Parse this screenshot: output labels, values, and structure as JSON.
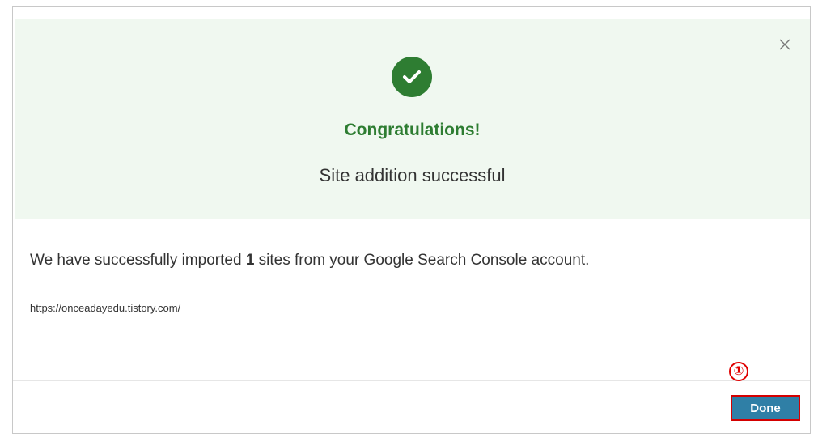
{
  "dialog": {
    "title": "Congratulations!",
    "subtitle": "Site addition successful",
    "message_prefix": "We have successfully imported ",
    "message_count": "1",
    "message_suffix": " sites from your Google Search Console account.",
    "site_url": "https://onceadayedu.tistory.com/",
    "done_label": "Done",
    "close_icon": "close-icon",
    "success_icon": "checkmark-circle-icon"
  },
  "annotation": {
    "marker": "①"
  },
  "colors": {
    "hero_background": "#f0f8f0",
    "success_green": "#2e7d32",
    "button_blue": "#2f7fa6",
    "annotation_red": "#e00000"
  }
}
